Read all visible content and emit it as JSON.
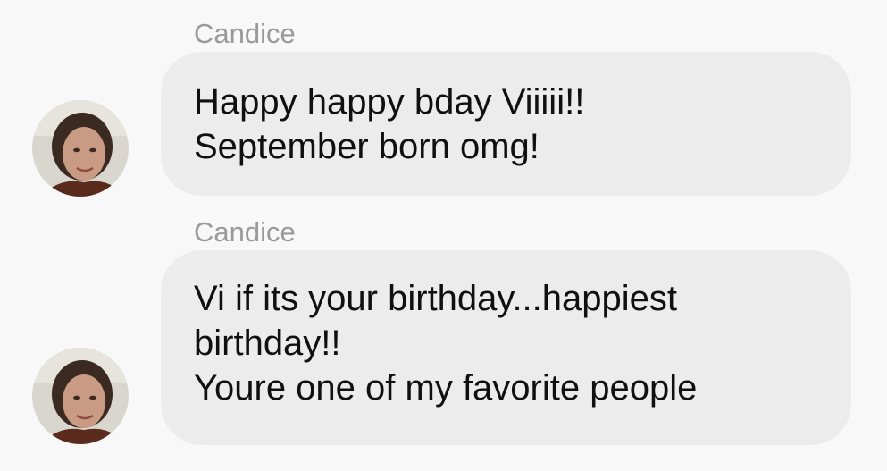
{
  "messages": [
    {
      "sender": "Candice",
      "text": "Happy happy bday Viiiii!!\nSeptember born omg!",
      "avatar_icon": "user-avatar-icon"
    },
    {
      "sender": "Candice",
      "text": "Vi if its your birthday...happiest\nbirthday!!\nYoure one of my favorite people",
      "avatar_icon": "user-avatar-icon"
    }
  ],
  "colors": {
    "background": "#f8f8f8",
    "bubble": "#ececec",
    "sender_name": "#9a9a9a",
    "message_text": "#101010"
  }
}
